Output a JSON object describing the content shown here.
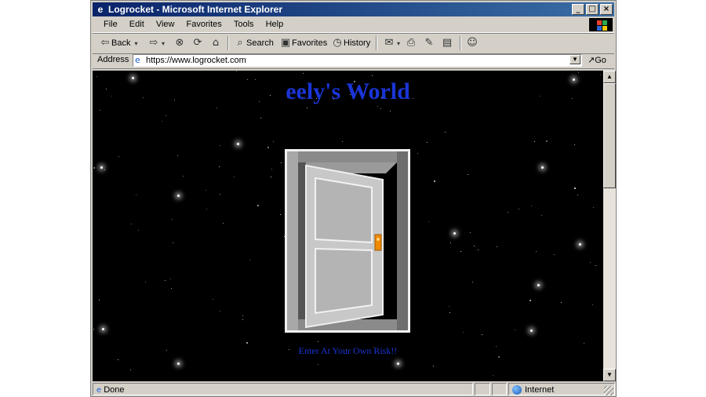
{
  "window": {
    "title": "Logrocket - Microsoft Internet Explorer",
    "min_glyph": "_",
    "max_glyph": "□",
    "close_glyph": "×"
  },
  "menu": {
    "items": [
      "File",
      "Edit",
      "View",
      "Favorites",
      "Tools",
      "Help"
    ]
  },
  "toolbar": {
    "back": "Back",
    "search": "Search",
    "favorites": "Favorites",
    "history": "History"
  },
  "address": {
    "label": "Address",
    "url": "https://www.logrocket.com",
    "go": "Go"
  },
  "page": {
    "title": "eely's World",
    "enter_text": "Enter At Your Own Risk!!"
  },
  "status": {
    "text": "Done",
    "zone": "Internet"
  },
  "colors": {
    "title_blue": "#1a35d6",
    "background": "#000000",
    "door_knob": "#f08a00"
  }
}
